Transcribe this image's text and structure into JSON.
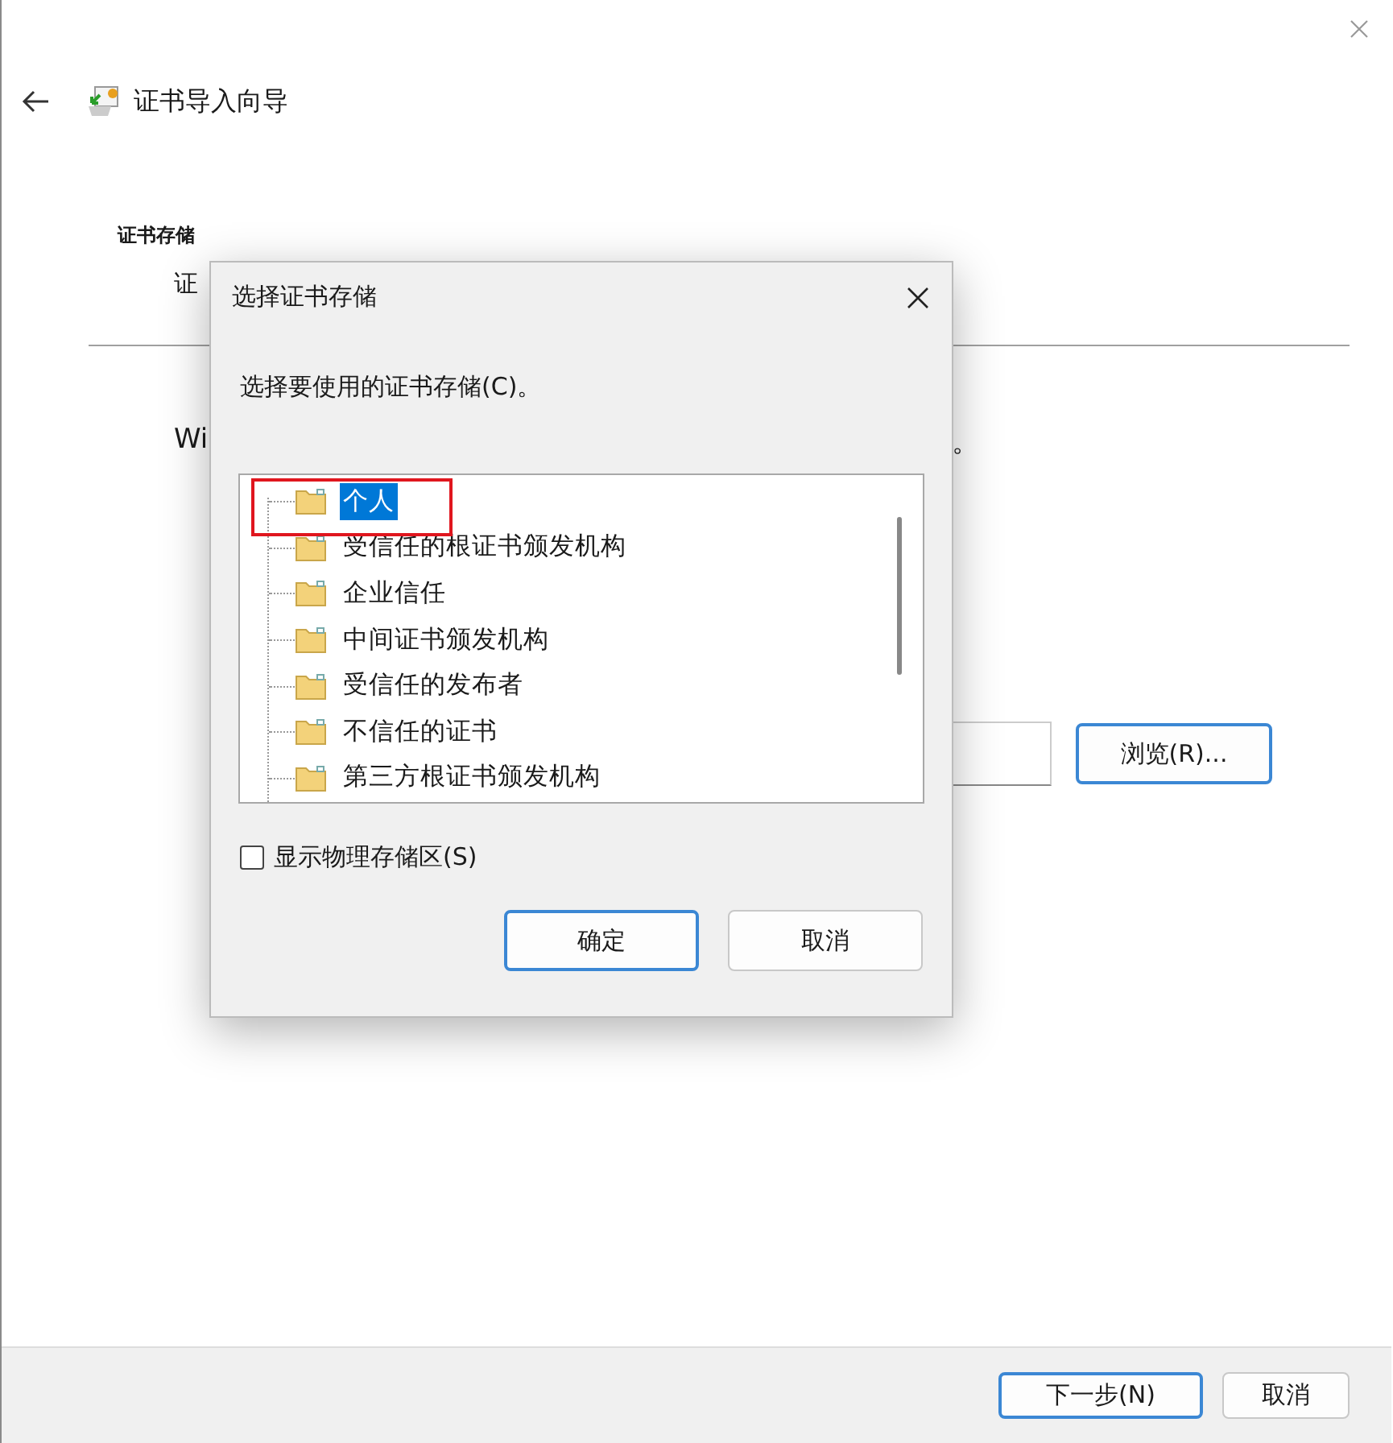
{
  "wizard": {
    "title": "证书导入向导",
    "section_heading": "证书存储",
    "section_subtitle": "证",
    "body_text_start": "Wi",
    "body_text_end": "。",
    "browse_button": "浏览(R)...",
    "buttons": [
      {
        "label": "下一步(N)",
        "default": true
      },
      {
        "label": "取消",
        "default": false
      }
    ]
  },
  "dialog": {
    "title": "选择证书存储",
    "prompt": "选择要使用的证书存储(C)。",
    "stores": [
      {
        "label": "个人",
        "selected": true
      },
      {
        "label": "受信任的根证书颁发机构",
        "selected": false
      },
      {
        "label": "企业信任",
        "selected": false
      },
      {
        "label": "中间证书颁发机构",
        "selected": false
      },
      {
        "label": "受信任的发布者",
        "selected": false
      },
      {
        "label": "不信任的证书",
        "selected": false
      },
      {
        "label": "第三方根证书颁发机构",
        "selected": false
      }
    ],
    "show_physical": {
      "label": "显示物理存储区(S)",
      "checked": false
    },
    "buttons": [
      {
        "label": "确定",
        "default": true
      },
      {
        "label": "取消",
        "default": false
      }
    ]
  }
}
